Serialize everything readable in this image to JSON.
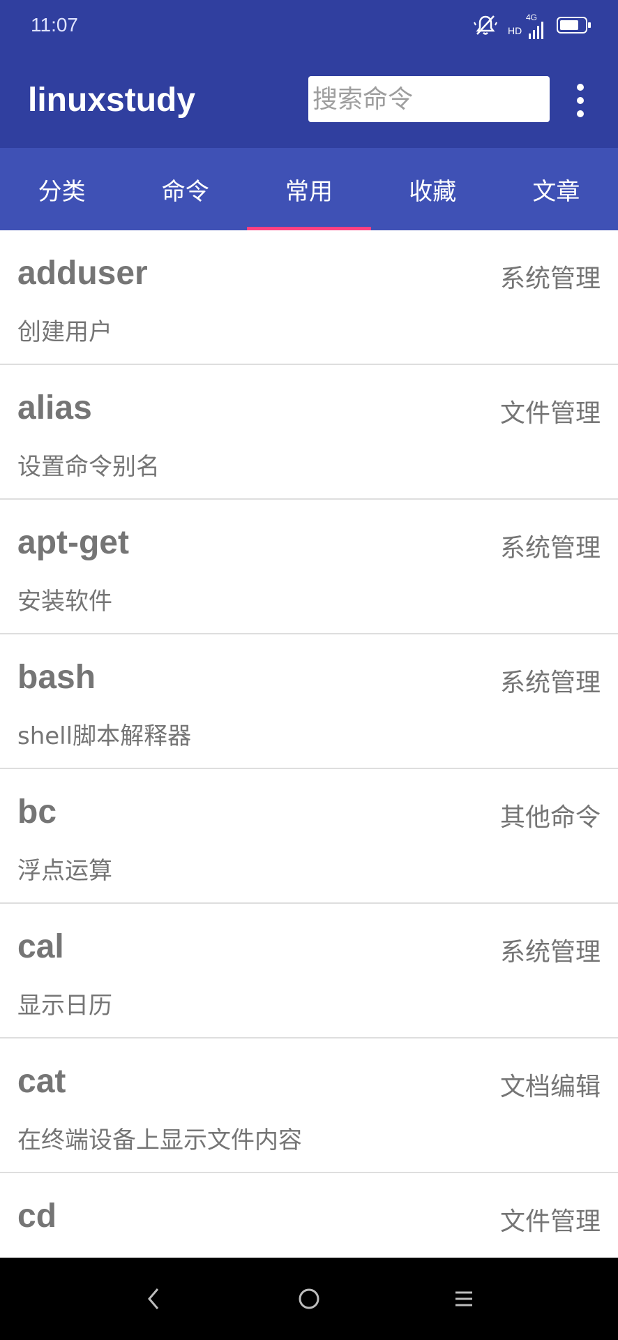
{
  "status": {
    "time": "11:07",
    "network_label": "4G",
    "hd_label": "HD"
  },
  "app": {
    "title": "linuxstudy",
    "search_placeholder": "搜索命令",
    "search_value": ""
  },
  "tabs": [
    {
      "label": "分类",
      "active": false
    },
    {
      "label": "命令",
      "active": false
    },
    {
      "label": "常用",
      "active": true
    },
    {
      "label": "收藏",
      "active": false
    },
    {
      "label": "文章",
      "active": false
    }
  ],
  "commands": [
    {
      "name": "adduser",
      "category": "系统管理",
      "desc": "创建用户"
    },
    {
      "name": "alias",
      "category": "文件管理",
      "desc": "设置命令别名"
    },
    {
      "name": "apt-get",
      "category": "系统管理",
      "desc": "安装软件"
    },
    {
      "name": "bash",
      "category": "系统管理",
      "desc": "shell脚本解释器"
    },
    {
      "name": "bc",
      "category": "其他命令",
      "desc": "浮点运算"
    },
    {
      "name": "cal",
      "category": "系统管理",
      "desc": "显示日历"
    },
    {
      "name": "cat",
      "category": "文档编辑",
      "desc": "在终端设备上显示文件内容"
    },
    {
      "name": "cd",
      "category": "文件管理",
      "desc": ""
    }
  ],
  "colors": {
    "primary_dark": "#303F9F",
    "primary": "#3F51B5",
    "accent": "#FF4081",
    "text_gray": "#757575"
  },
  "icons": {
    "mute": "bell-off-icon",
    "signal": "signal-icon",
    "battery": "battery-icon",
    "back": "back-icon",
    "home": "home-icon",
    "recents": "recents-icon",
    "overflow": "more-vert-icon"
  }
}
